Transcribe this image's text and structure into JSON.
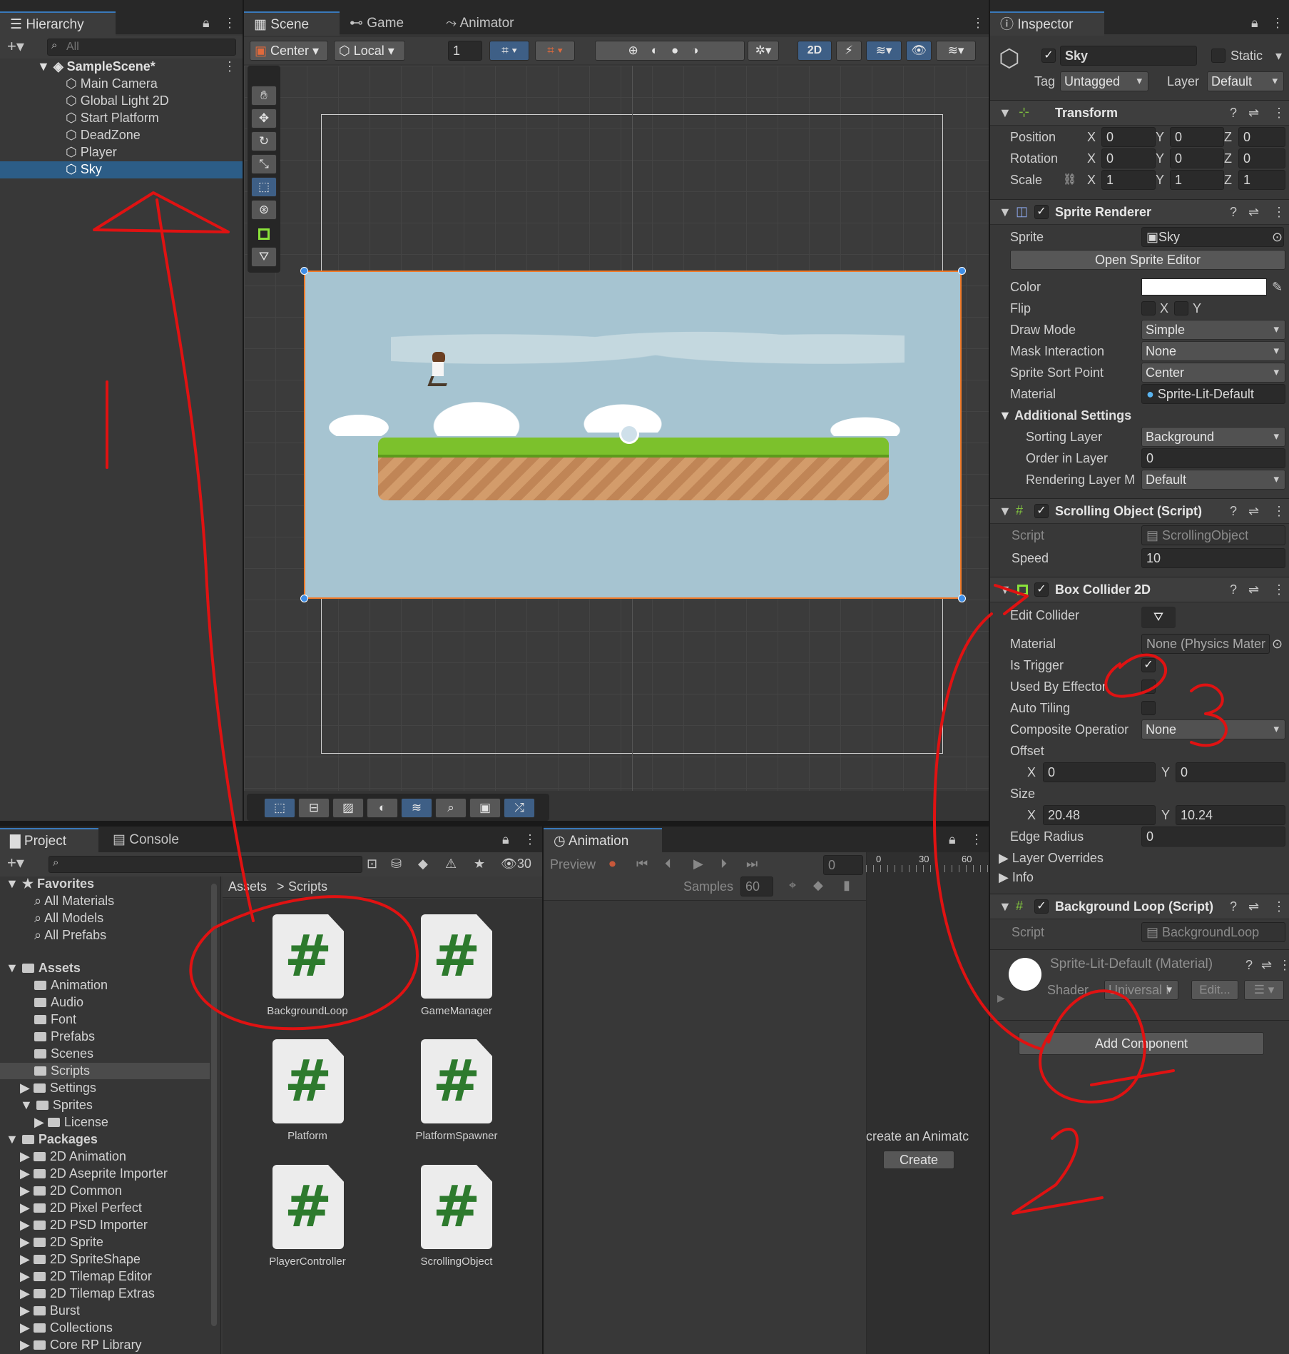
{
  "hierarchy": {
    "tab": "Hierarchy",
    "search_placeholder": "All",
    "scene": "SampleScene*",
    "items": [
      "Main Camera",
      "Global Light 2D",
      "Start Platform",
      "DeadZone",
      "Player",
      "Sky"
    ],
    "selected": "Sky"
  },
  "scene_view": {
    "tabs": [
      "Scene",
      "Game",
      "Animator"
    ],
    "pivot": "Center",
    "space": "Local",
    "grid_value": "1",
    "mode_2d": "2D"
  },
  "inspector": {
    "tab": "Inspector",
    "object_name": "Sky",
    "static_label": "Static",
    "tag_label": "Tag",
    "tag": "Untagged",
    "layer_label": "Layer",
    "layer": "Default",
    "transform": {
      "title": "Transform",
      "rows": [
        {
          "label": "Position",
          "x": "0",
          "y": "0",
          "z": "0"
        },
        {
          "label": "Rotation",
          "x": "0",
          "y": "0",
          "z": "0"
        },
        {
          "label": "Scale",
          "x": "1",
          "y": "1",
          "z": "1"
        }
      ]
    },
    "sprite_renderer": {
      "title": "Sprite Renderer",
      "sprite_label": "Sprite",
      "sprite": "Sky",
      "open_editor": "Open Sprite Editor",
      "color_label": "Color",
      "flip_label": "Flip",
      "flip_x": "X",
      "flip_y": "Y",
      "draw_mode_label": "Draw Mode",
      "draw_mode": "Simple",
      "mask_label": "Mask Interaction",
      "mask": "None",
      "sort_point_label": "Sprite Sort Point",
      "sort_point": "Center",
      "material_label": "Material",
      "material": "Sprite-Lit-Default",
      "additional": "Additional Settings",
      "sorting_layer_label": "Sorting Layer",
      "sorting_layer": "Background",
      "order_label": "Order in Layer",
      "order": "0",
      "rendering_layer_label": "Rendering Layer M",
      "rendering_layer": "Default"
    },
    "scrolling_object": {
      "title": "Scrolling Object (Script)",
      "script_label": "Script",
      "script": "ScrollingObject",
      "speed_label": "Speed",
      "speed": "10"
    },
    "box_collider": {
      "title": "Box Collider 2D",
      "edit_label": "Edit Collider",
      "material_label": "Material",
      "material": "None (Physics Mater",
      "trigger_label": "Is Trigger",
      "effector_label": "Used By Effector",
      "tiling_label": "Auto Tiling",
      "composite_label": "Composite Operatior",
      "composite": "None",
      "offset_label": "Offset",
      "offset_x": "0",
      "offset_y": "0",
      "size_label": "Size",
      "size_x": "20.48",
      "size_y": "10.24",
      "edge_label": "Edge Radius",
      "edge": "0",
      "layer_overrides": "Layer Overrides",
      "info": "Info"
    },
    "background_loop": {
      "title": "Background Loop (Script)",
      "script_label": "Script",
      "script": "BackgroundLoop"
    },
    "material_block": {
      "title": "Sprite-Lit-Default (Material)",
      "shader_label": "Shader",
      "shader": "Universal I",
      "edit": "Edit..."
    },
    "add_component": "Add Component"
  },
  "project": {
    "tabs": [
      "Project",
      "Console"
    ],
    "hidden_count": "30",
    "favorites": "Favorites",
    "fav_items": [
      "All Materials",
      "All Models",
      "All Prefabs"
    ],
    "assets": "Assets",
    "asset_items": [
      "Animation",
      "Audio",
      "Font",
      "Prefabs",
      "Scenes",
      "Scripts",
      "Settings",
      "Sprites",
      "License"
    ],
    "packages": "Packages",
    "package_items": [
      "2D Animation",
      "2D Aseprite Importer",
      "2D Common",
      "2D Pixel Perfect",
      "2D PSD Importer",
      "2D Sprite",
      "2D SpriteShape",
      "2D Tilemap Editor",
      "2D Tilemap Extras",
      "Burst",
      "Collections",
      "Core RP Library"
    ],
    "breadcrumb": [
      "Assets",
      "Scripts"
    ],
    "scripts": [
      "BackgroundLoop",
      "GameManager",
      "Platform",
      "PlatformSpawner",
      "PlayerController",
      "ScrollingObject"
    ]
  },
  "animation": {
    "tab": "Animation",
    "preview": "Preview",
    "frame": "0",
    "samples_label": "Samples",
    "samples": "60",
    "hint": "create an Animatc",
    "create": "Create",
    "ruler": [
      "0",
      "30",
      "60"
    ]
  },
  "annotations": [
    "1",
    "2",
    "3"
  ],
  "colors": {
    "selection": "#2c5d87",
    "accent": "#3a79bb",
    "sky": "#a6c4d1",
    "grass": "#7cc12c",
    "dirt": "#c99264",
    "annotation": "#e01212"
  }
}
